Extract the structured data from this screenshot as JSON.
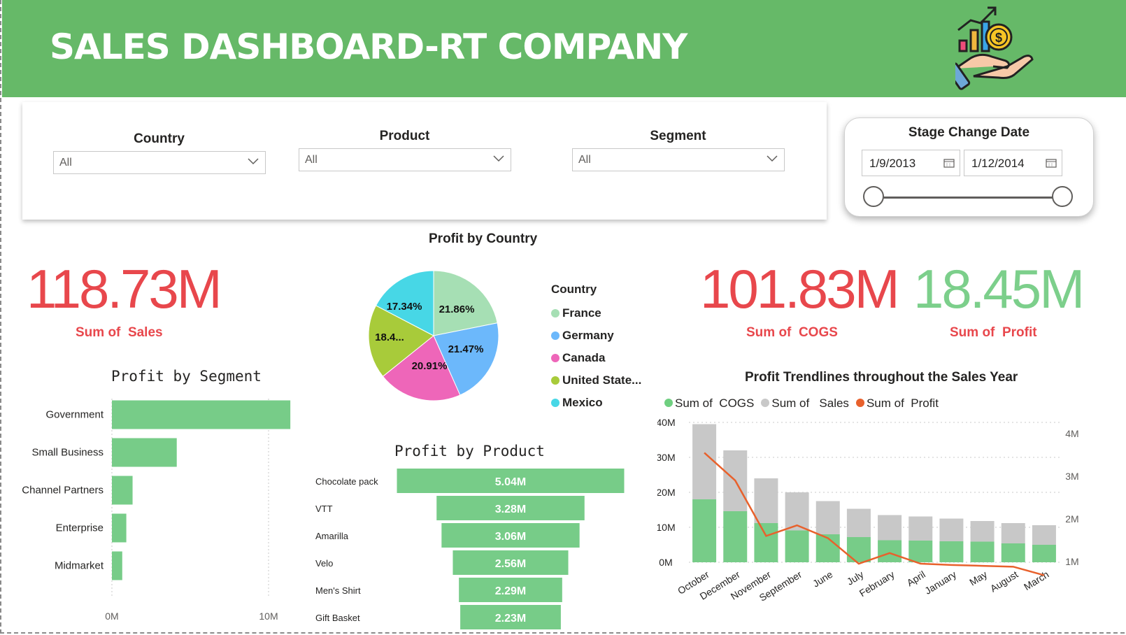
{
  "header": {
    "title": "SALES DASHBOARD-RT COMPANY",
    "logo_icon": "hand-money-growth-icon"
  },
  "filters": {
    "country": {
      "label": "Country",
      "value": "All"
    },
    "product": {
      "label": "Product",
      "value": "All"
    },
    "segment": {
      "label": "Segment",
      "value": "All"
    },
    "date": {
      "label": "Stage Change Date",
      "start": "1/9/2013",
      "end": "1/12/2014"
    }
  },
  "kpis": {
    "sales": {
      "value": "118.73M",
      "label": "Sum of  Sales"
    },
    "cogs": {
      "value": "101.83M",
      "label": "Sum of  COGS"
    },
    "profit": {
      "value": "18.45M",
      "label": "Sum of  Profit"
    }
  },
  "colors": {
    "header": "#66b968",
    "kpi_red": "#e8474c",
    "kpi_green": "#7ccf8b",
    "bar_green": "#77cc88",
    "bar_gray": "#c8c8c8",
    "line_orange": "#e8612c"
  },
  "chart_data": [
    {
      "type": "pie",
      "title": "Profit by Country",
      "legend_title": "Country",
      "legend_position": "right",
      "slices": [
        {
          "label": "France",
          "legend_label": "France",
          "value": 21.86,
          "display": "21.86%",
          "color": "#a6dfb4"
        },
        {
          "label": "Germany",
          "legend_label": "Germany",
          "value": 21.47,
          "display": "21.47%",
          "color": "#6cb8fb"
        },
        {
          "label": "Canada",
          "legend_label": "Canada",
          "value": 20.91,
          "display": "20.91%",
          "color": "#ee66b9"
        },
        {
          "label": "United States of America",
          "legend_label": "United State...",
          "value": 18.42,
          "display": "18.4...",
          "color": "#a8cb3a"
        },
        {
          "label": "Mexico",
          "legend_label": "Mexico",
          "value": 17.34,
          "display": "17.34%",
          "color": "#47d7e6"
        }
      ]
    },
    {
      "type": "bar",
      "orientation": "horizontal",
      "title": "Profit by Segment",
      "categories": [
        "Government",
        "Small Business",
        "Channel Partners",
        "Enterprise",
        "Midmarket"
      ],
      "values": [
        11.39,
        4.14,
        1.32,
        0.92,
        0.66
      ],
      "xlim": [
        0,
        12
      ],
      "x_ticks": [
        {
          "value": 0,
          "label": "0M"
        },
        {
          "value": 10,
          "label": "10M"
        }
      ],
      "grid": true
    },
    {
      "type": "bar",
      "orientation": "funnel",
      "title": "Profit by Product",
      "categories": [
        "Chocolate pack",
        "VTT",
        "Amarilla",
        "Velo",
        "Men's Shirt",
        "Gift Basket"
      ],
      "values": [
        5.04,
        3.28,
        3.06,
        2.56,
        2.29,
        2.23
      ],
      "labels": [
        "5.04M",
        "3.28M",
        "3.06M",
        "2.56M",
        "2.29M",
        "2.23M"
      ]
    },
    {
      "type": "bar",
      "subtype": "stacked-bar-with-line",
      "title": "Profit Trendlines throughout the Sales Year",
      "legend_position": "top-left",
      "categories": [
        "October",
        "December",
        "November",
        "September",
        "June",
        "July",
        "February",
        "April",
        "January",
        "May",
        "August",
        "March"
      ],
      "series": [
        {
          "name": "Sum of  COGS",
          "values": [
            18,
            14.6,
            11.2,
            9.1,
            8.0,
            7.2,
            6.3,
            6.2,
            6.0,
            5.9,
            5.4,
            5.0
          ]
        },
        {
          "name": "Sum of   Sales",
          "values": [
            39.5,
            32.0,
            24.0,
            20.0,
            17.5,
            15.3,
            13.5,
            13.1,
            12.5,
            11.8,
            11.2,
            10.6
          ]
        },
        {
          "name": "Sum of  Profit",
          "axis": "right",
          "values": [
            3.55,
            2.9,
            1.6,
            1.85,
            1.55,
            0.95,
            1.2,
            0.95,
            0.92,
            0.9,
            0.88,
            0.68
          ]
        }
      ],
      "ylim": [
        0,
        40
      ],
      "y_ticks": [
        "0M",
        "10M",
        "20M",
        "30M",
        "40M"
      ],
      "y2lim": [
        0,
        4
      ],
      "y2_ticks": [
        "1M",
        "2M",
        "3M",
        "4M"
      ],
      "grid": true
    }
  ]
}
